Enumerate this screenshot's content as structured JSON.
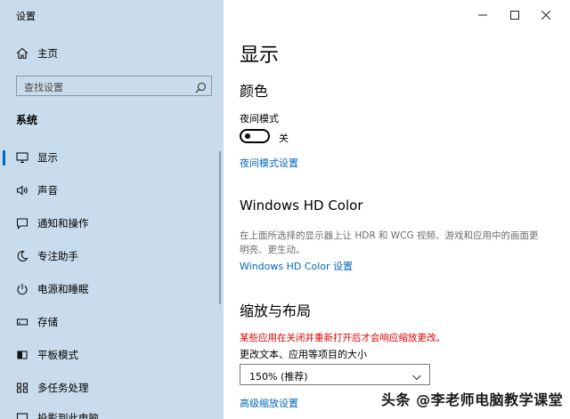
{
  "window": {
    "title": "设置"
  },
  "sidebar": {
    "home": "主页",
    "search_placeholder": "查找设置",
    "section": "系统",
    "items": [
      {
        "label": "显示",
        "icon": "monitor-icon",
        "active": true
      },
      {
        "label": "声音",
        "icon": "speaker-icon"
      },
      {
        "label": "通知和操作",
        "icon": "notification-icon"
      },
      {
        "label": "专注助手",
        "icon": "moon-icon"
      },
      {
        "label": "电源和睡眠",
        "icon": "power-icon"
      },
      {
        "label": "存储",
        "icon": "storage-icon"
      },
      {
        "label": "平板模式",
        "icon": "tablet-icon"
      },
      {
        "label": "多任务处理",
        "icon": "multitask-icon"
      },
      {
        "label": "投影到此电脑",
        "icon": "project-icon"
      }
    ]
  },
  "main": {
    "title": "显示",
    "color_heading": "颜色",
    "night_light_label": "夜间模式",
    "night_light_state": "关",
    "night_light_settings_link": "夜间模式设置",
    "hd_heading": "Windows HD Color",
    "hd_desc": "在上面所选择的显示器上让 HDR 和 WCG 视频、游戏和应用中的画面更明亮、更生动。",
    "hd_link": "Windows HD Color 设置",
    "scale_heading": "缩放与布局",
    "scale_warning": "某些应用在关闭并重新打开后才会响应缩放更改。",
    "scale_label": "更改文本、应用等项目的大小",
    "scale_value": "150% (推荐)",
    "advanced_link": "高级缩放设置"
  },
  "watermark": "头条 @李老师电脑教学课堂",
  "colors": {
    "accent": "#0067c0",
    "sidebar_bg": "#c9dceb",
    "warning": "#e00000"
  }
}
